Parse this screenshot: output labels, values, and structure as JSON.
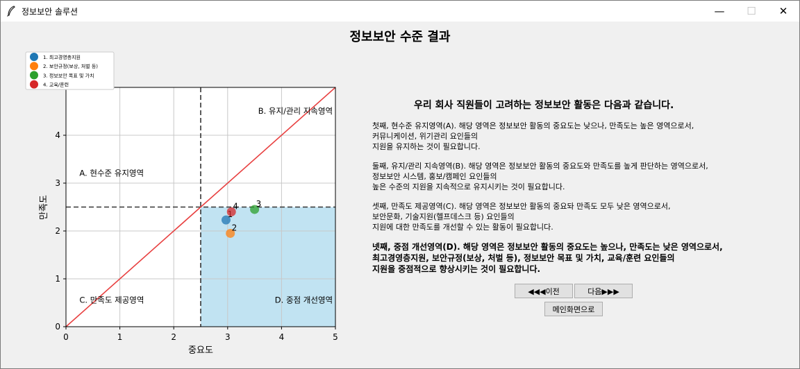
{
  "window": {
    "title": "정보보안 솔루션",
    "controls": {
      "minimize": "—",
      "maximize": "☐",
      "close": "✕"
    }
  },
  "heading": "정보보안 수준 결과",
  "chart_data": {
    "type": "scatter",
    "xlabel": "중요도",
    "ylabel": "만족도",
    "xlim": [
      0,
      5
    ],
    "ylim": [
      0,
      5
    ],
    "xticks": [
      "0",
      "1",
      "2",
      "3",
      "4",
      "5"
    ],
    "yticks": [
      "0",
      "1",
      "2",
      "3",
      "4"
    ],
    "grid": true,
    "legend_position": "top-left",
    "thresholds": {
      "x": 2.5,
      "y": 2.5
    },
    "quadrant_labels": {
      "A": "A. 현수준 유지영역",
      "B": "B. 유지/관리 지속영역",
      "C": "C. 만족도 제공영역",
      "D": "D. 중점 개선영역"
    },
    "highlight_color": "#c1e3f2",
    "diagonal_color": "#e84040",
    "series": [
      {
        "name": "1. 최고경영층지원",
        "label": "1",
        "x": 2.97,
        "y": 2.23,
        "color": "#1f77b4"
      },
      {
        "name": "2. 보안규정(보상, 처벌 등)",
        "label": "2",
        "x": 3.05,
        "y": 1.95,
        "color": "#ff7f0e"
      },
      {
        "name": "3. 정보보안 목표 및 가치",
        "label": "3",
        "x": 3.5,
        "y": 2.45,
        "color": "#2ca02c"
      },
      {
        "name": "4. 교육/훈련",
        "label": "4",
        "x": 3.07,
        "y": 2.4,
        "color": "#d62728"
      }
    ]
  },
  "info": {
    "title": "우리 회사 직원들이 고려하는 정보보안 활동은 다음과 같습니다.",
    "p1": "첫째, 현수준 유지영역(A). 해당 영역은 정보보안 활동의 중요도는 낮으나, 만족도는 높은 영역으로서,\n커뮤니케이션, 위기관리 요인들의\n지원을 유지하는 것이 필요합니다.",
    "p2": "둘째, 유지/관리 지속영역(B). 해당 영역은 정보보안 활동의 중요도와 만족도를 높게 판단하는 영역으로서,\n정보보안 시스템, 홍보/캠페인 요인들의\n높은 수준의 지원을 지속적으로 유지시키는 것이 필요합니다.",
    "p3": "셋째, 만족도 제공영역(C). 해당 영역은 정보보안 활동의 중요돠 만족도 모두 낮은 영역으로서,\n보안문화, 기술지원(헬프데스크 등) 요인들의\n지원에 대한 만족도를 개선할 수 있는 활동이 필요합니다.",
    "p4": "넷째, 중점 개선영역(D). 해당 영역은 정보보안 활동의 중요도는 높으나, 만족도는 낮은 영역으로서,\n최고경영층지원, 보안규정(보상, 처벌 등), 정보보안 목표 및 가치, 교육/훈련 요인들의\n지원을 중점적으로 향상시키는 것이 필요합니다."
  },
  "buttons": {
    "prev": "◀◀◀이전",
    "next": "다음▶▶▶",
    "main": "메인화면으로"
  }
}
